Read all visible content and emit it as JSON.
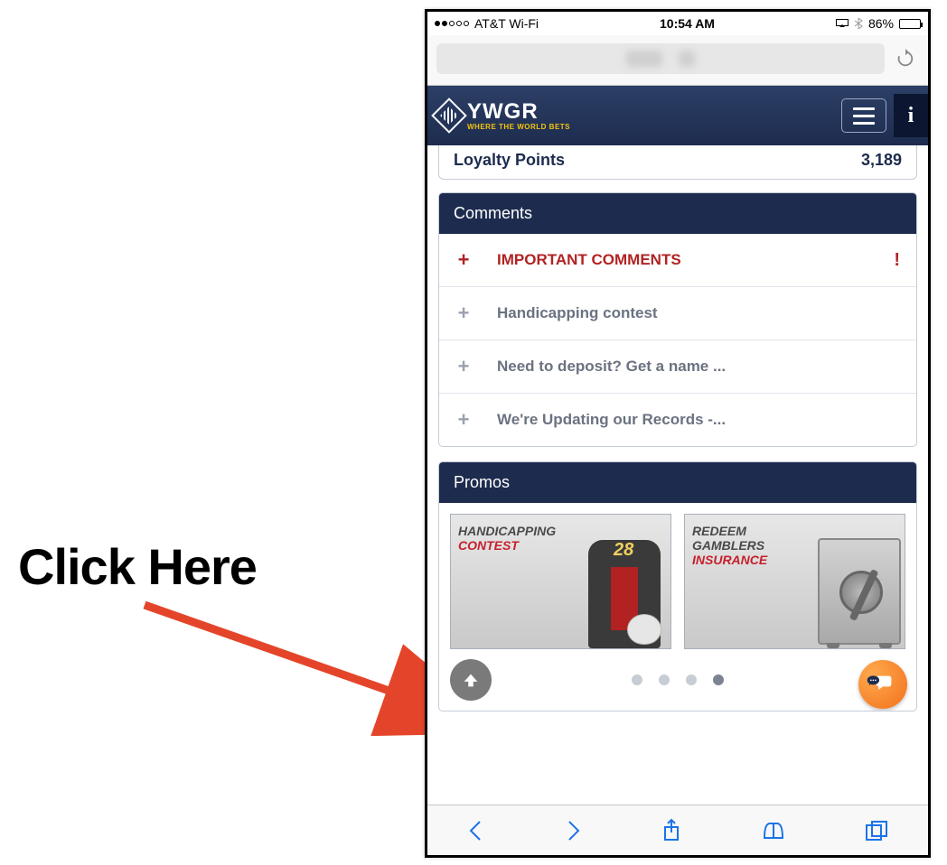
{
  "annotation": {
    "label": "Click Here"
  },
  "status_bar": {
    "carrier": "AT&T Wi-Fi",
    "time": "10:54 AM",
    "battery_pct": "86%"
  },
  "app_header": {
    "brand": "YWGR",
    "tagline": "WHERE THE WORLD BETS"
  },
  "loyalty": {
    "label": "Loyalty Points",
    "value": "3,189"
  },
  "comments": {
    "title": "Comments",
    "items": [
      {
        "label": "IMPORTANT COMMENTS",
        "important": true
      },
      {
        "label": "Handicapping contest"
      },
      {
        "label": "Need to deposit? Get a name ..."
      },
      {
        "label": "We're Updating our Records -..."
      }
    ]
  },
  "promos": {
    "title": "Promos",
    "cards": [
      {
        "line1": "HANDICAPPING",
        "line2_accent": "CONTEST"
      },
      {
        "line1": "REDEEM",
        "line2": "GAMBLERS",
        "line3_accent": "INSURANCE"
      }
    ],
    "dot_count": 4,
    "active_dot": 3
  },
  "icons": {
    "plus": "+",
    "bang": "!",
    "info": "i",
    "jersey_num": "28"
  }
}
